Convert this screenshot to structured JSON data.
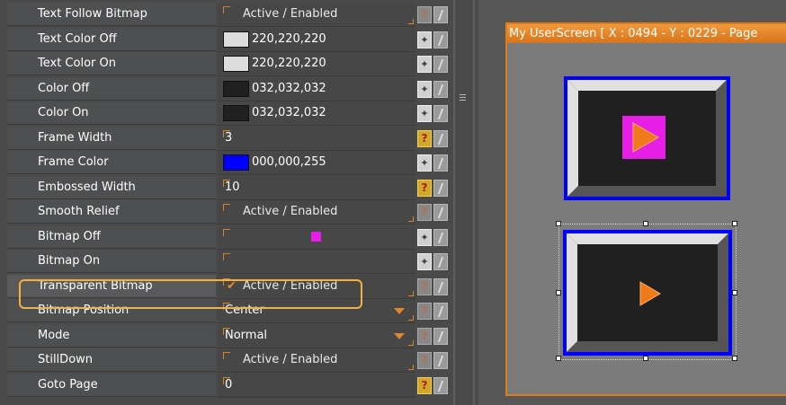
{
  "properties": [
    {
      "name": "Text Follow Bitmap",
      "type": "check",
      "checked": false,
      "value": "Active / Enabled",
      "button": "help-dim"
    },
    {
      "name": "Text Color Off",
      "type": "color",
      "color": "#dcdcdc",
      "value": "220,220,220",
      "button": "wand"
    },
    {
      "name": "Text Color On",
      "type": "color",
      "color": "#dcdcdc",
      "value": "220,220,220",
      "button": "wand"
    },
    {
      "name": "Color Off",
      "type": "color",
      "color": "#202020",
      "value": "032,032,032",
      "button": "wand"
    },
    {
      "name": "Color On",
      "type": "color",
      "color": "#202020",
      "value": "032,032,032",
      "button": "wand"
    },
    {
      "name": "Frame Width",
      "type": "text",
      "value": "3",
      "button": "help"
    },
    {
      "name": "Frame Color",
      "type": "color",
      "color": "#0000ff",
      "value": "000,000,255",
      "button": "wand"
    },
    {
      "name": "Embossed Width",
      "type": "text",
      "value": "10",
      "button": "help"
    },
    {
      "name": "Smooth Relief",
      "type": "check",
      "checked": false,
      "value": "Active / Enabled",
      "button": "help-dim"
    },
    {
      "name": "Bitmap Off",
      "type": "bitmap",
      "value": "",
      "button": "wand"
    },
    {
      "name": "Bitmap On",
      "type": "empty",
      "value": "",
      "button": "wand"
    },
    {
      "name": "Transparent Bitmap",
      "type": "check",
      "checked": true,
      "value": "Active / Enabled",
      "button": "help-dim",
      "selected": true
    },
    {
      "name": "Bitmap Position",
      "type": "dropdown",
      "value": "Center",
      "button": "help-dim"
    },
    {
      "name": "Mode",
      "type": "dropdown",
      "value": "Normal",
      "button": "help-dim"
    },
    {
      "name": "StillDown",
      "type": "check",
      "checked": false,
      "value": "Active / Enabled",
      "button": "help-dim"
    },
    {
      "name": "Goto Page",
      "type": "text",
      "value": "0",
      "button": "help"
    }
  ],
  "window": {
    "title": "My UserScreen [ X : 0494 - Y : 0229 - Page"
  },
  "colors": {
    "accent": "#e07c1a",
    "highlight": "#f4b23c",
    "frame": "#0000ff",
    "bitmap": "#e61ee6",
    "arrow": "#f07a1a"
  },
  "icons": {
    "help": "question-mark-icon",
    "wand": "magic-wand-icon",
    "edit": "pencil-icon",
    "check": "checkmark-icon",
    "dropdown": "dropdown-arrow-icon",
    "play": "play-arrow-icon"
  }
}
